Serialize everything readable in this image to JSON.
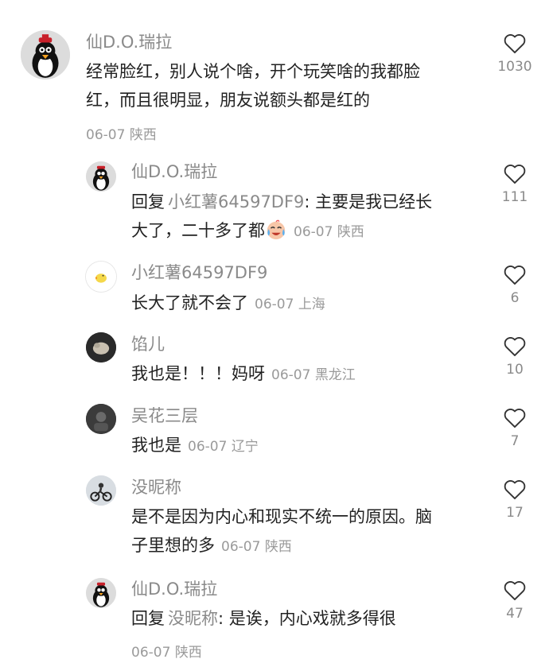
{
  "comments": [
    {
      "name": "仙D.O.瑞拉",
      "text_line1": "经常脸红，别人说个啥，开个玩笑啥的我都脸",
      "text_line2": "红，而且很明显，朋友说额头都是红的",
      "date": "06-07",
      "location": "陕西",
      "likes": "1030",
      "avatar_icon": "penguin-avatar-icon"
    },
    {
      "name": "仙D.O.瑞拉",
      "reply_prefix": "回复",
      "reply_to": "小红薯64597DF9",
      "line1": ": 主要是我已经长",
      "line2": "大了，二十多了都",
      "emoji": "crying-laugh-emoji-icon",
      "date": "06-07",
      "location": "陕西",
      "likes": "111"
    },
    {
      "name": "小红薯64597DF9",
      "text": "长大了就不会了",
      "date": "06-07",
      "location": "上海",
      "likes": "6"
    },
    {
      "name": "馅儿",
      "text": "我也是！！！妈呀",
      "date": "06-07",
      "location": "黑龙江",
      "likes": "10"
    },
    {
      "name": "吴花三层",
      "text": "我也是",
      "date": "06-07",
      "location": "辽宁",
      "likes": "7"
    },
    {
      "name": "没昵称",
      "line1": "是不是因为内心和现实不统一的原因。脑",
      "line2": "子里想的多",
      "date": "06-07",
      "location": "陕西",
      "likes": "17"
    },
    {
      "name": "仙D.O.瑞拉",
      "reply_prefix": "回复",
      "reply_to": "没昵称",
      "line1": ": 是诶，内心戏就多得很",
      "date": "06-07",
      "location": "陕西",
      "likes": "47"
    }
  ]
}
